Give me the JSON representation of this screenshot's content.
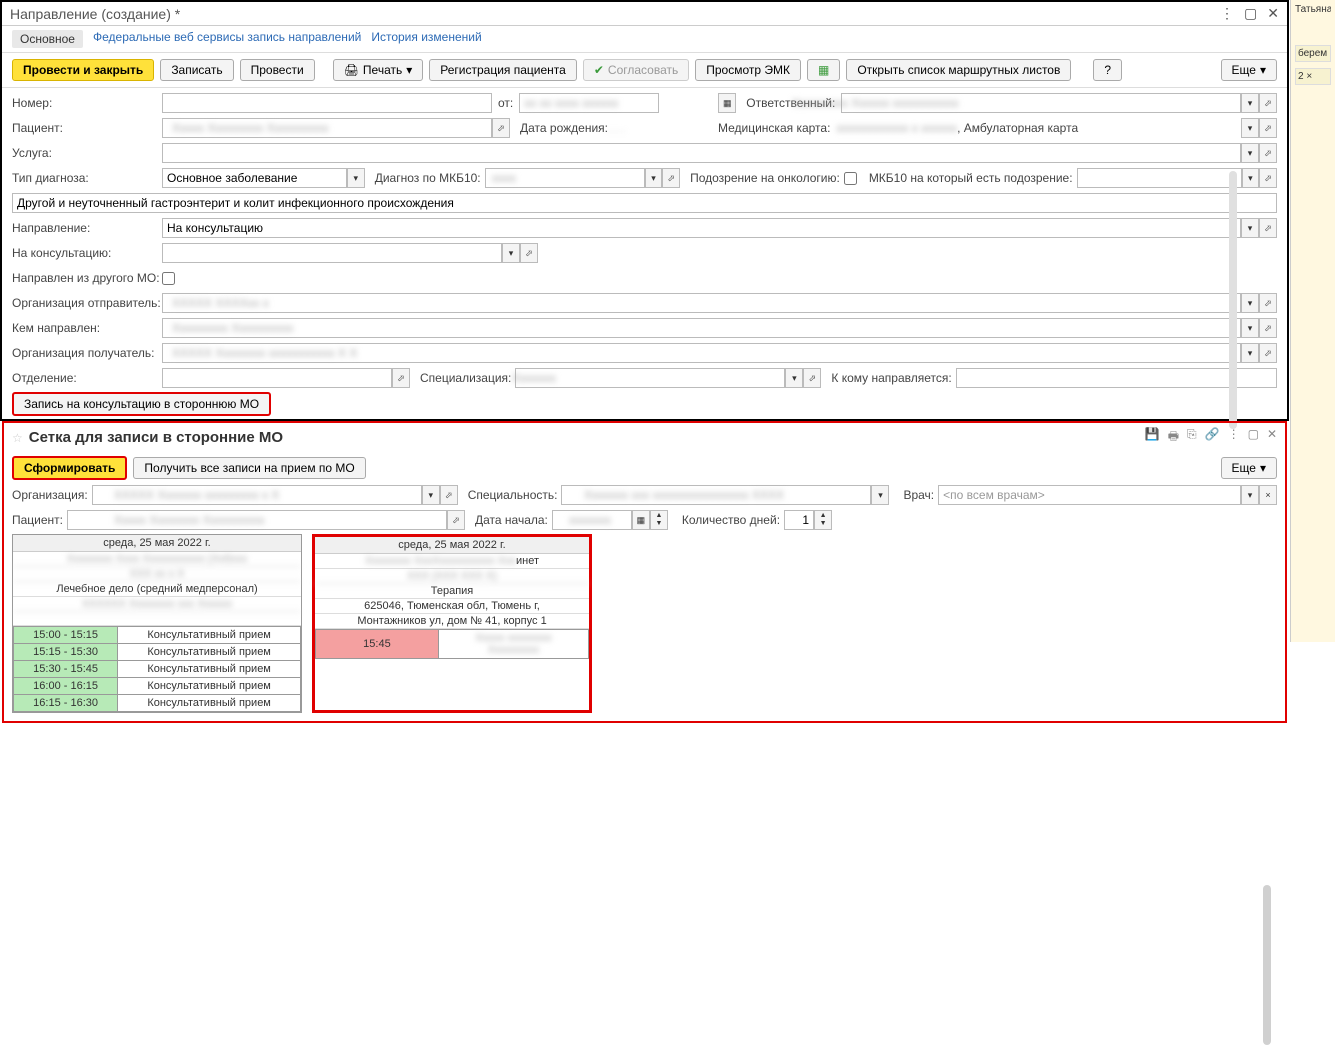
{
  "window": {
    "title": "Направление (создание) *"
  },
  "tabs": {
    "main": "Основное",
    "fed": "Федеральные веб сервисы запись направлений",
    "hist": "История изменений"
  },
  "toolbar": {
    "run_close": "Провести и закрыть",
    "save": "Записать",
    "run": "Провести",
    "print": "Печать",
    "reg": "Регистрация пациента",
    "agree": "Согласовать",
    "emk": "Просмотр ЭМК",
    "routes": "Открыть список маршрутных листов",
    "help": "?",
    "more": "Еще"
  },
  "labels": {
    "number": "Номер:",
    "from": "от:",
    "resp": "Ответственный:",
    "patient": "Пациент:",
    "dob": "Дата рождения:",
    "medcard": "Медицинская карта:",
    "medcard_suffix": ", Амбулаторная карта",
    "service": "Услуга:",
    "diag_type": "Тип диагноза:",
    "diag_type_val": "Основное заболевание",
    "mkb": "Диагноз по МКБ10:",
    "onko": "Подозрение на онкологию:",
    "mkb_susp": "МКБ10 на который есть подозрение:",
    "diag_text": "Другой и неуточненный гастроэнтерит и колит инфекционного происхождения",
    "referral": "Направление:",
    "referral_val": "На консультацию",
    "consult_to": "На консультацию:",
    "from_other_mo": "Направлен из другого МО:",
    "org_sender": "Организация отправитель:",
    "sent_by": "Кем направлен:",
    "org_receiver": "Организация получатель:",
    "dept": "Отделение:",
    "spec": "Специализация:",
    "to_whom": "К кому направляется:",
    "ext_consult_btn": "Запись на консультацию в стороннюю МО"
  },
  "panel": {
    "title": "Сетка для записи в сторонние МО",
    "form_btn": "Сформировать",
    "get_all": "Получить все записи на прием по МО",
    "more": "Еще",
    "org": "Организация:",
    "specialty": "Специальность:",
    "doctor": "Врач:",
    "doctor_ph": "<по всем врачам>",
    "patient": "Пациент:",
    "start": "Дата начала:",
    "days": "Количество дней:",
    "days_val": "1"
  },
  "sched1": {
    "date": "среда, 25 мая 2022 г.",
    "header2": "Лечебное дело (средний медперсонал)",
    "slots": [
      {
        "time": "15:00 - 15:15",
        "type": "Консультативный прием"
      },
      {
        "time": "15:15 - 15:30",
        "type": "Консультативный прием"
      },
      {
        "time": "15:30 - 15:45",
        "type": "Консультативный прием"
      },
      {
        "time": "16:00 - 16:15",
        "type": "Консультативный прием"
      },
      {
        "time": "16:15 - 16:30",
        "type": "Консультативный прием"
      }
    ]
  },
  "sched2": {
    "date": "среда, 25 мая 2022 г.",
    "cab_suffix": "инет",
    "spec": "Терапия",
    "addr1": "625046, Тюменская обл, Тюмень г,",
    "addr2": "Монтажников ул, дом № 41, корпус 1",
    "slot_time": "15:45"
  },
  "sidebar": {
    "tag1": "Татьяна",
    "tag2": "берем",
    "tag3": "2 ×"
  }
}
